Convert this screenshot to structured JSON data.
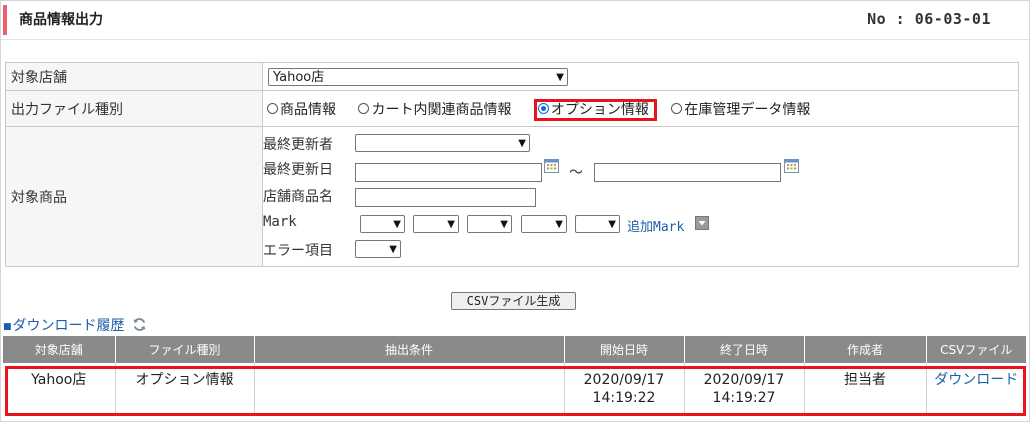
{
  "header": {
    "title": "商品情報出力",
    "number": "No : 06-03-01"
  },
  "form": {
    "store": {
      "label": "対象店舗",
      "value": "Yahoo店"
    },
    "filetype": {
      "label": "出力ファイル種別",
      "options": [
        {
          "label": "商品情報",
          "selected": false
        },
        {
          "label": "カート内関連商品情報",
          "selected": false
        },
        {
          "label": "オプション情報",
          "selected": true
        },
        {
          "label": "在庫管理データ情報",
          "selected": false
        }
      ]
    },
    "products": {
      "label": "対象商品",
      "updater_label": "最終更新者",
      "updated_label": "最終更新日",
      "tilde": "～",
      "shop_name_label": "店舗商品名",
      "mark_label": "Mark",
      "add_mark": "追加Mark",
      "error_label": "エラー項目"
    }
  },
  "csv_button": "CSVファイル生成",
  "history": {
    "title": "ダウンロード履歴",
    "columns": [
      "対象店舗",
      "ファイル種別",
      "抽出条件",
      "開始日時",
      "終了日時",
      "作成者",
      "CSVファイル"
    ],
    "rows": [
      {
        "store": "Yahoo店",
        "type": "オプション情報",
        "condition": "",
        "start_date": "2020/09/17",
        "start_time": "14:19:22",
        "end_date": "2020/09/17",
        "end_time": "14:19:27",
        "author": "担当者",
        "file": "ダウンロード"
      }
    ]
  },
  "colors": {
    "accent": "#e8636b",
    "highlight": "#e8141c",
    "link": "#1a5fa8",
    "header_bg": "#8a8a8a"
  }
}
